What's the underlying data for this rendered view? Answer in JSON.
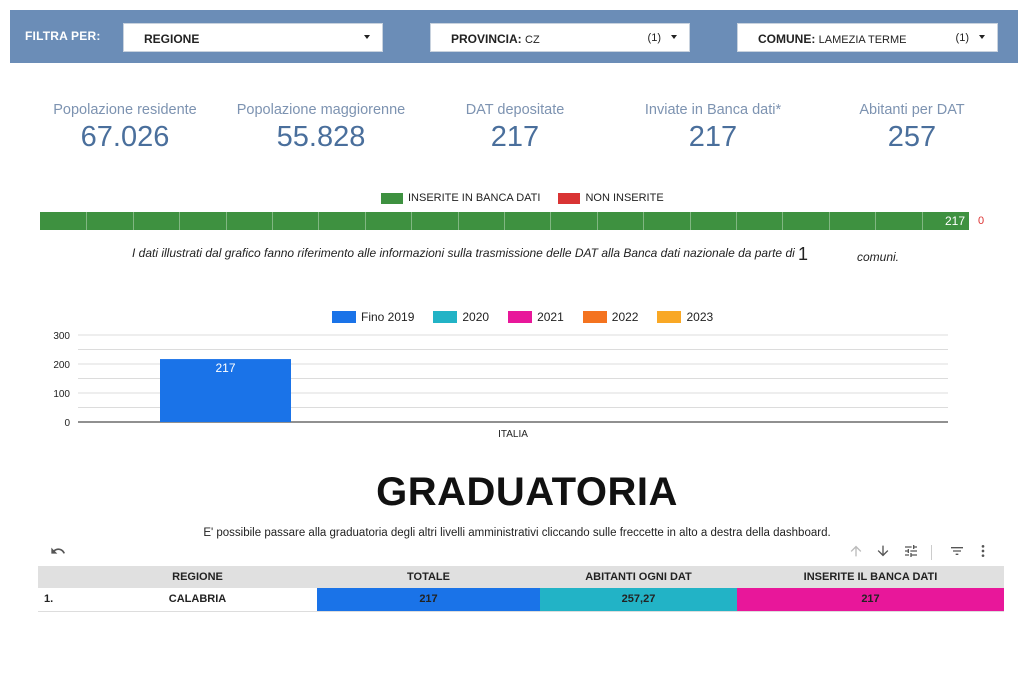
{
  "filters": {
    "label": "FILTRA PER:",
    "regione": {
      "label": "REGIONE"
    },
    "provincia": {
      "label": "PROVINCIA:",
      "value": "CZ",
      "count": "(1)"
    },
    "comune": {
      "label": "COMUNE:",
      "value": "LAMEZIA TERME",
      "count": "(1)"
    }
  },
  "kpis": [
    {
      "label": "Popolazione residente",
      "value": "67.026"
    },
    {
      "label": "Popolazione maggiorenne",
      "value": "55.828"
    },
    {
      "label": "DAT depositate",
      "value": "217"
    },
    {
      "label": "Inviate in Banca dati*",
      "value": "217"
    },
    {
      "label": "Abitanti per DAT",
      "value": "257"
    }
  ],
  "transmission": {
    "legend": [
      {
        "label": "INSERITE IN BANCA DATI",
        "color": "#3e9140"
      },
      {
        "label": "NON INSERITE",
        "color": "#d93434"
      }
    ],
    "inserite": 217,
    "inserite_label": "217",
    "non_inserite_label": "0",
    "note": "I dati illustrati dal grafico fanno riferimento alle informazioni sulla trasmissione delle DAT alla Banca dati nazionale da parte di",
    "note_count": "1",
    "note_end": "comuni."
  },
  "chart_data": {
    "type": "bar",
    "categories": [
      "ITALIA"
    ],
    "series": [
      {
        "name": "Fino 2019",
        "values": [
          217
        ],
        "color": "#1a73e8"
      },
      {
        "name": "2020",
        "values": [
          0
        ],
        "color": "#22b3c6"
      },
      {
        "name": "2021",
        "values": [
          0
        ],
        "color": "#e8179a"
      },
      {
        "name": "2022",
        "values": [
          0
        ],
        "color": "#f4731f"
      },
      {
        "name": "2023",
        "values": [
          0
        ],
        "color": "#f9a825"
      }
    ],
    "data_labels": [
      "217"
    ],
    "yticks": [
      "0",
      "100",
      "200",
      "300"
    ],
    "ylim": [
      0,
      300
    ],
    "grid": true,
    "legend_position": "top"
  },
  "graduatoria": {
    "title": "GRADUATORIA",
    "subtitle": "E' possibile passare alla graduatoria degli altri livelli amministrativi cliccando sulle freccette in alto a destra della dashboard.",
    "columns": [
      "REGIONE",
      "TOTALE",
      "ABITANTI OGNI DAT",
      "INSERITE IL BANCA DATI"
    ],
    "rows": [
      {
        "index": "1.",
        "regione": "CALABRIA",
        "totale": "217",
        "abitanti": "257,27",
        "inserite": "217"
      }
    ]
  },
  "icons": [
    "undo-icon",
    "arrow-up-icon",
    "arrow-down-icon",
    "tune-icon",
    "filter-icon",
    "more-vert-icon"
  ]
}
